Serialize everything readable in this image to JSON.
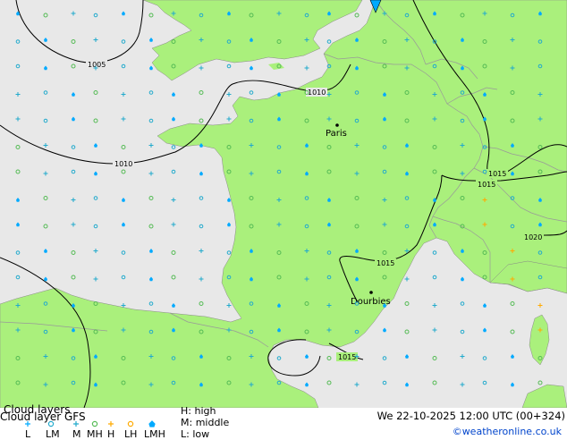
{
  "colors": {
    "land": "#aaf07c",
    "sea": "#e8e8e8",
    "border": "#aaaaaa",
    "isobar": "#000000",
    "high": "#ffaa00",
    "middle": "#22aacc",
    "low": "#00aaff",
    "high_middle": "#55bb55",
    "copyright": "#0044cc"
  },
  "title": "Cloud layers",
  "model_label": "Cloud layer GFS",
  "valid_time": "We 22-10-2025 12:00 UTC (00+324)",
  "copyright": "©weatheronline.co.uk",
  "legend_items": [
    {
      "code": "L",
      "icon": "low-cloud-icon"
    },
    {
      "code": "LM",
      "icon": "low-middle-cloud-icon"
    },
    {
      "code": "M",
      "icon": "middle-cloud-icon"
    },
    {
      "code": "MH",
      "icon": "middle-high-cloud-icon"
    },
    {
      "code": "H",
      "icon": "high-cloud-icon"
    },
    {
      "code": "LH",
      "icon": "low-high-cloud-icon"
    },
    {
      "code": "LMH",
      "icon": "low-middle-high-cloud-icon"
    }
  ],
  "key": {
    "high": "H: high",
    "middle": "M: middle",
    "low": "L: low"
  },
  "cities": [
    "Paris",
    "Dourbies"
  ],
  "isobars": [
    "1005",
    "1010",
    "1010",
    "1015",
    "1015",
    "1020",
    "1015",
    "1015"
  ]
}
